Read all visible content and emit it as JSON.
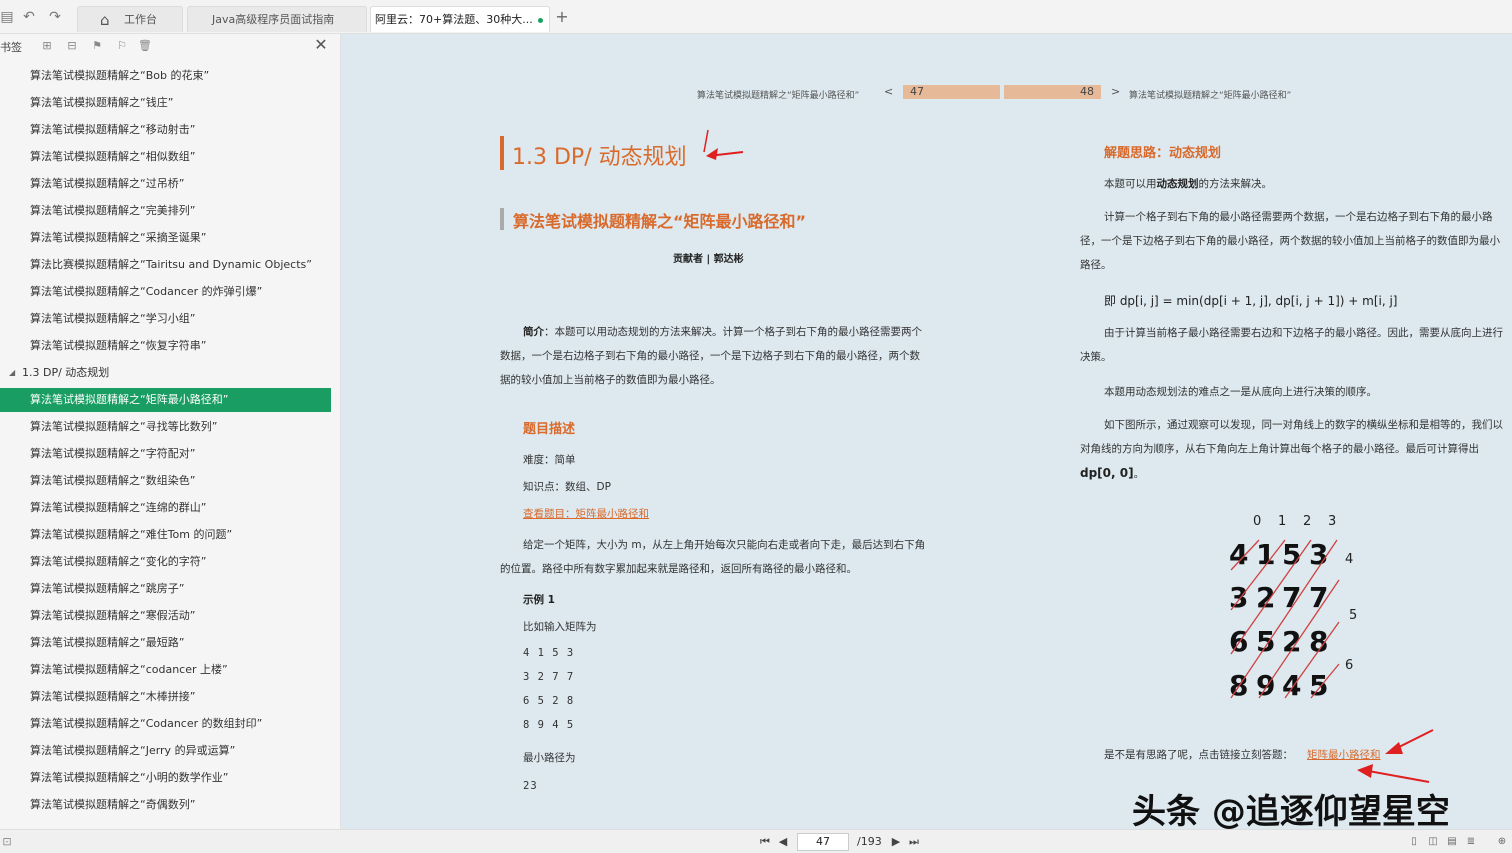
{
  "topbar": {
    "tabs": [
      {
        "label": "工作台",
        "icon": "home-icon"
      },
      {
        "label": "Java高级程序员面试指南"
      },
      {
        "label": "阿里云：70+算法题、30种大...",
        "active": true
      }
    ],
    "add_tab": "+"
  },
  "sidebar": {
    "title": "书签",
    "close": "✕",
    "items": [
      {
        "label": "算法笔试模拟题精解之“Bob 的花束”"
      },
      {
        "label": "算法笔试模拟题精解之“钱庄”"
      },
      {
        "label": "算法笔试模拟题精解之“移动射击”"
      },
      {
        "label": "算法笔试模拟题精解之“相似数组”"
      },
      {
        "label": "算法笔试模拟题精解之“过吊桥”"
      },
      {
        "label": "算法笔试模拟题精解之“完美排列”"
      },
      {
        "label": "算法笔试模拟题精解之“采摘圣诞果”"
      },
      {
        "label": "算法比赛模拟题精解之“Tairitsu and Dynamic Objects”"
      },
      {
        "label": "算法笔试模拟题精解之“Codancer 的炸弹引爆”"
      },
      {
        "label": "算法笔试模拟题精解之“学习小组”"
      },
      {
        "label": "算法笔试模拟题精解之“恢复字符串”"
      },
      {
        "label": "1.3    DP/ 动态规划",
        "section": true
      },
      {
        "label": "算法笔试模拟题精解之“矩阵最小路径和”",
        "selected": true
      },
      {
        "label": "算法笔试模拟题精解之“寻找等比数列”"
      },
      {
        "label": "算法笔试模拟题精解之“字符配对”"
      },
      {
        "label": "算法笔试模拟题精解之“数组染色”"
      },
      {
        "label": "算法笔试模拟题精解之“连绵的群山”"
      },
      {
        "label": "算法笔试模拟题精解之“难住Tom 的问题”"
      },
      {
        "label": "算法笔试模拟题精解之“变化的字符”"
      },
      {
        "label": "算法笔试模拟题精解之“跳房子”"
      },
      {
        "label": "算法笔试模拟题精解之“寒假活动”"
      },
      {
        "label": "算法笔试模拟题精解之“最短路”"
      },
      {
        "label": "算法笔试模拟题精解之“codancer 上楼”"
      },
      {
        "label": "算法笔试模拟题精解之“木棒拼接”"
      },
      {
        "label": "算法笔试模拟题精解之“Codancer 的数组封印”"
      },
      {
        "label": "算法笔试模拟题精解之“Jerry 的异或运算”"
      },
      {
        "label": "算法笔试模拟题精解之“小明的数学作业”"
      },
      {
        "label": "算法笔试模拟题精解之“奇偶数列”"
      }
    ]
  },
  "doc": {
    "left_crumb": "算法笔试模拟题精解之“矩阵最小路径和”",
    "right_crumb": "算法笔试模拟题精解之“矩阵最小路径和”",
    "prev_arrow": "<",
    "next_arrow": ">",
    "page_left": "47",
    "page_right": "48",
    "chapter_title": "1.3    DP/ 动态规划",
    "section_title": "算法笔试模拟题精解之“矩阵最小路径和”",
    "author": "贡献者 | 郭达彬",
    "intro_label": "简介",
    "intro_text": "：本题可以用动态规划的方法来解决。计算一个格子到右下角的最小路径需要两个数据，一个是右边格子到右下角的最小路径，一个是下边格子到右下角的最小路径，两个数据的较小值加上当前格子的数值即为最小路径。",
    "desc_heading": "题目描述",
    "difficulty": "难度：简单",
    "knowledge": "知识点：数组、DP",
    "view_link": "查看题目：矩阵最小路径和",
    "problem_text": "给定一个矩阵，大小为 m，从左上角开始每次只能向右走或者向下走，最后达到右下角的位置。路径中所有数字累加起来就是路径和，返回所有路径的最小路径和。",
    "example_label": "示例 1",
    "example_intro": "比如输入矩阵为",
    "matrix_rows": [
      "4 1 5 3",
      "3 2 7 7",
      "6 5 2 8",
      "8 9 4 5"
    ],
    "min_label": "最小路径为",
    "min_value": "23",
    "solution_heading": "解题思路：动态规划",
    "sol_p1_a": "本题可以用",
    "sol_p1_b": "动态规划",
    "sol_p1_c": "的方法来解决。",
    "sol_p2": "计算一个格子到右下角的最小路径需要两个数据，一个是右边格子到右下角的最小路径，一个是下边格子到右下角的最小路径，两个数据的较小值加上当前格子的数值即为最小路径。",
    "formula": "即 dp[i, j] = min(dp[i + 1, j], dp[i, j + 1]) + m[i, j]",
    "sol_p3": "由于计算当前格子最小路径需要右边和下边格子的最小路径。因此，需要从底向上进行决策。",
    "sol_p4": "本题用动态规划法的难点之一是从底向上进行决策的顺序。",
    "sol_p5_a": "如下图所示，通过观察可以发现，同一对角线上的数字的横纵坐标和是相等的，我们以对角线的方向为顺序，从右下角向左上角计算出每个格子的最小路径。最后可计算得出 ",
    "sol_p5_b": "dp[0, 0]",
    "sol_p5_c": "。",
    "figure": {
      "col_indices": [
        "0",
        "1",
        "2",
        "3"
      ],
      "cells": [
        [
          "4",
          "1",
          "5",
          "3"
        ],
        [
          "3",
          "2",
          "7",
          "7"
        ],
        [
          "6",
          "5",
          "2",
          "8"
        ],
        [
          "8",
          "9",
          "4",
          "5"
        ]
      ],
      "diag_indices": [
        "4",
        "5",
        "6"
      ]
    },
    "answer_prompt": "是不是有思路了呢，点击链接立刻答题：",
    "answer_link": "矩阵最小路径和",
    "watermark": "头条 @追逐仰望星空"
  },
  "bottombar": {
    "current_page": "47",
    "total_pages": "/193"
  },
  "colors": {
    "accent_orange": "#d96a2c",
    "selected_green": "#1a9d62",
    "doc_bg": "#dde9ef",
    "annotation_red": "#e02020"
  }
}
